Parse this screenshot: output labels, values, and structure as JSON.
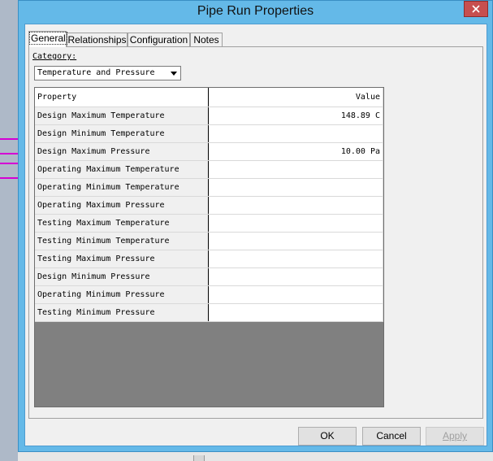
{
  "window": {
    "title": "Pipe Run Properties"
  },
  "tabs": [
    {
      "label": "General"
    },
    {
      "label": "Relationships"
    },
    {
      "label": "Configuration"
    },
    {
      "label": "Notes"
    }
  ],
  "category": {
    "label": "Category:",
    "selected": "Temperature and Pressure"
  },
  "grid": {
    "header": {
      "property": "Property",
      "value": "Value"
    },
    "rows": [
      {
        "property": "Design Maximum Temperature",
        "value": "148.89 C"
      },
      {
        "property": "Design Minimum Temperature",
        "value": ""
      },
      {
        "property": "Design Maximum Pressure",
        "value": "10.00 Pa"
      },
      {
        "property": "Operating Maximum Temperature",
        "value": ""
      },
      {
        "property": "Operating Minimum Temperature",
        "value": ""
      },
      {
        "property": "Operating Maximum Pressure",
        "value": ""
      },
      {
        "property": "Testing Maximum Temperature",
        "value": ""
      },
      {
        "property": "Testing Minimum Temperature",
        "value": ""
      },
      {
        "property": "Testing Maximum Pressure",
        "value": ""
      },
      {
        "property": "Design Minimum Pressure",
        "value": ""
      },
      {
        "property": "Operating Minimum Pressure",
        "value": ""
      },
      {
        "property": "Testing Minimum Pressure",
        "value": ""
      }
    ]
  },
  "buttons": {
    "ok": "OK",
    "cancel": "Cancel",
    "apply": "Apply"
  },
  "colors": {
    "titlebar": "#64b9e8",
    "close": "#c74f4f",
    "grid_empty": "#808080"
  }
}
